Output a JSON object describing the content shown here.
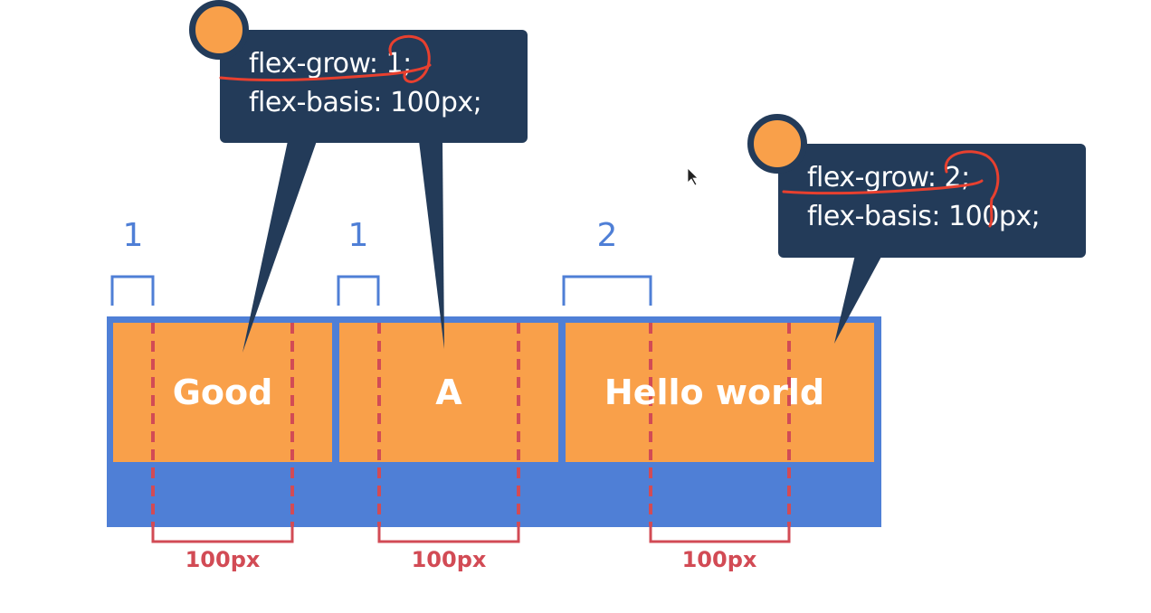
{
  "tooltip_left": {
    "line1": "flex-grow: 1;",
    "line2": "flex-basis: 100px;"
  },
  "tooltip_right": {
    "line1": "flex-grow: 2;",
    "line2": "flex-basis: 100px;"
  },
  "grow_labels": [
    "1",
    "1",
    "2"
  ],
  "items": [
    "Good",
    "A",
    "Hello world"
  ],
  "basis_labels": [
    "100px",
    "100px",
    "100px"
  ],
  "colors": {
    "item_orange": "#f9a04a",
    "container_blue": "#4f7fd6",
    "tooltip_navy": "#233b59",
    "basis_red": "#d24b55",
    "annotation_red": "#e8402f"
  }
}
